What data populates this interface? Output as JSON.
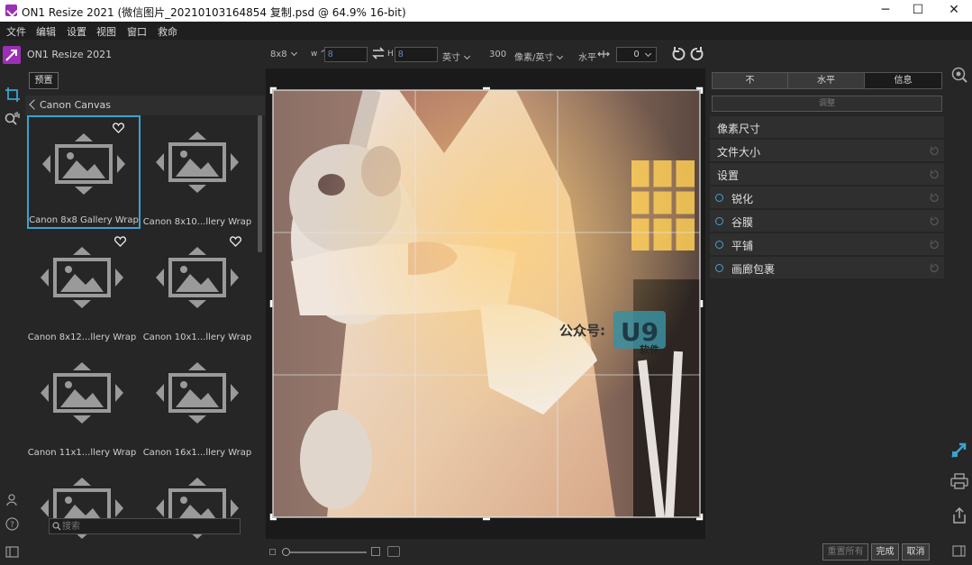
{
  "window": {
    "title": "ON1 Resize 2021 (微信图片_20210103164854 复制.psd @ 64.9% 16-bit)",
    "minimize": "─",
    "maximize": "☐",
    "close": "✕"
  },
  "menu": [
    "文件",
    "编辑",
    "设置",
    "视图",
    "窗口",
    "救命"
  ],
  "app": {
    "name": "ON1 Resize 2021"
  },
  "toolbar": {
    "preset_size": "8x8",
    "w_label": "w ^",
    "w_value": "8",
    "h_label": "H",
    "h_value": "8",
    "unit": "英寸",
    "resolution": "300",
    "resolution_unit": "像素/英寸",
    "horizontal_label": "水平",
    "rotation": "0"
  },
  "left_panel": {
    "preset_button": "预置",
    "category": "Canon Canvas",
    "presets": [
      {
        "label": "Canon 8x8 Gallery Wrap",
        "favorite": true,
        "selected": true
      },
      {
        "label": "Canon 8x10...llery Wrap",
        "favorite": false,
        "selected": false
      },
      {
        "label": "Canon 8x12...llery Wrap",
        "favorite": true,
        "selected": false
      },
      {
        "label": "Canon 10x1...llery Wrap",
        "favorite": true,
        "selected": false
      },
      {
        "label": "Canon 11x1...llery Wrap",
        "favorite": false,
        "selected": false
      },
      {
        "label": "Canon 16x1...llery Wrap",
        "favorite": false,
        "selected": false
      },
      {
        "label": "",
        "favorite": false,
        "selected": false
      },
      {
        "label": "",
        "favorite": false,
        "selected": false
      }
    ],
    "search_placeholder": "搜索"
  },
  "canvas": {
    "watermark_text": "公众号:",
    "watermark_logo": "U9",
    "watermark_sub": "软件"
  },
  "right_panel": {
    "tabs": [
      "不",
      "水平",
      "信息"
    ],
    "active_tab": 2,
    "adjust_button": "调整",
    "sections": [
      {
        "label": "像素尺寸",
        "sub": false,
        "resettable": false
      },
      {
        "label": "文件大小",
        "sub": false,
        "resettable": true
      },
      {
        "label": "设置",
        "sub": false,
        "resettable": true
      },
      {
        "label": "锐化",
        "sub": true,
        "resettable": true
      },
      {
        "label": "谷膜",
        "sub": true,
        "resettable": true
      },
      {
        "label": "平铺",
        "sub": true,
        "resettable": true
      },
      {
        "label": "画廊包裹",
        "sub": true,
        "resettable": true
      }
    ]
  },
  "footer": {
    "reset_all": "重置所有",
    "done": "完成",
    "cancel": "取消"
  },
  "colors": {
    "accent": "#3aa3d1",
    "background": "#262626",
    "canvas": "#1a1a1a",
    "input_text": "#6b8fc7"
  }
}
